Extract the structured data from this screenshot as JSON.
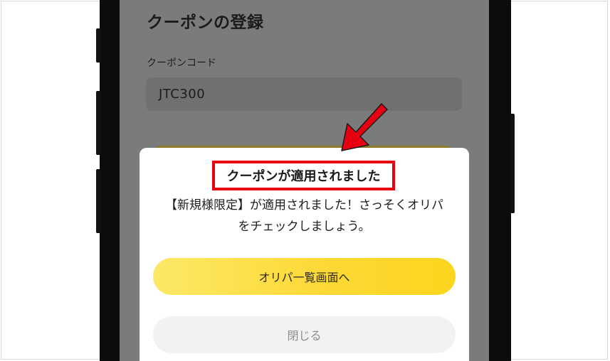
{
  "screen": {
    "page_title": "クーポンの登録",
    "coupon_label": "クーポンコード",
    "coupon_value": "JTC300"
  },
  "modal": {
    "title": "クーポンが適用されました",
    "message_line1": "【新規様限定】が適用されました！さっそくオリパ",
    "message_line2": "をチェックしましょう。",
    "primary_button": "オリパ一覧画面へ",
    "close_button": "閉じる"
  },
  "colors": {
    "highlight_border": "#e60012",
    "arrow": "#e60012",
    "primary_button": "#fdd834"
  },
  "icons": {
    "pointer": "red-arrow-icon"
  }
}
